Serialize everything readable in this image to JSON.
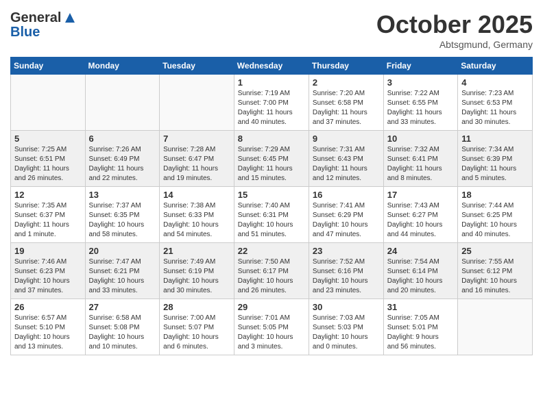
{
  "header": {
    "logo_general": "General",
    "logo_blue": "Blue",
    "month": "October 2025",
    "location": "Abtsgmund, Germany"
  },
  "days_of_week": [
    "Sunday",
    "Monday",
    "Tuesday",
    "Wednesday",
    "Thursday",
    "Friday",
    "Saturday"
  ],
  "weeks": [
    {
      "shaded": false,
      "days": [
        {
          "num": "",
          "info": ""
        },
        {
          "num": "",
          "info": ""
        },
        {
          "num": "",
          "info": ""
        },
        {
          "num": "1",
          "info": "Sunrise: 7:19 AM\nSunset: 7:00 PM\nDaylight: 11 hours\nand 40 minutes."
        },
        {
          "num": "2",
          "info": "Sunrise: 7:20 AM\nSunset: 6:58 PM\nDaylight: 11 hours\nand 37 minutes."
        },
        {
          "num": "3",
          "info": "Sunrise: 7:22 AM\nSunset: 6:55 PM\nDaylight: 11 hours\nand 33 minutes."
        },
        {
          "num": "4",
          "info": "Sunrise: 7:23 AM\nSunset: 6:53 PM\nDaylight: 11 hours\nand 30 minutes."
        }
      ]
    },
    {
      "shaded": true,
      "days": [
        {
          "num": "5",
          "info": "Sunrise: 7:25 AM\nSunset: 6:51 PM\nDaylight: 11 hours\nand 26 minutes."
        },
        {
          "num": "6",
          "info": "Sunrise: 7:26 AM\nSunset: 6:49 PM\nDaylight: 11 hours\nand 22 minutes."
        },
        {
          "num": "7",
          "info": "Sunrise: 7:28 AM\nSunset: 6:47 PM\nDaylight: 11 hours\nand 19 minutes."
        },
        {
          "num": "8",
          "info": "Sunrise: 7:29 AM\nSunset: 6:45 PM\nDaylight: 11 hours\nand 15 minutes."
        },
        {
          "num": "9",
          "info": "Sunrise: 7:31 AM\nSunset: 6:43 PM\nDaylight: 11 hours\nand 12 minutes."
        },
        {
          "num": "10",
          "info": "Sunrise: 7:32 AM\nSunset: 6:41 PM\nDaylight: 11 hours\nand 8 minutes."
        },
        {
          "num": "11",
          "info": "Sunrise: 7:34 AM\nSunset: 6:39 PM\nDaylight: 11 hours\nand 5 minutes."
        }
      ]
    },
    {
      "shaded": false,
      "days": [
        {
          "num": "12",
          "info": "Sunrise: 7:35 AM\nSunset: 6:37 PM\nDaylight: 11 hours\nand 1 minute."
        },
        {
          "num": "13",
          "info": "Sunrise: 7:37 AM\nSunset: 6:35 PM\nDaylight: 10 hours\nand 58 minutes."
        },
        {
          "num": "14",
          "info": "Sunrise: 7:38 AM\nSunset: 6:33 PM\nDaylight: 10 hours\nand 54 minutes."
        },
        {
          "num": "15",
          "info": "Sunrise: 7:40 AM\nSunset: 6:31 PM\nDaylight: 10 hours\nand 51 minutes."
        },
        {
          "num": "16",
          "info": "Sunrise: 7:41 AM\nSunset: 6:29 PM\nDaylight: 10 hours\nand 47 minutes."
        },
        {
          "num": "17",
          "info": "Sunrise: 7:43 AM\nSunset: 6:27 PM\nDaylight: 10 hours\nand 44 minutes."
        },
        {
          "num": "18",
          "info": "Sunrise: 7:44 AM\nSunset: 6:25 PM\nDaylight: 10 hours\nand 40 minutes."
        }
      ]
    },
    {
      "shaded": true,
      "days": [
        {
          "num": "19",
          "info": "Sunrise: 7:46 AM\nSunset: 6:23 PM\nDaylight: 10 hours\nand 37 minutes."
        },
        {
          "num": "20",
          "info": "Sunrise: 7:47 AM\nSunset: 6:21 PM\nDaylight: 10 hours\nand 33 minutes."
        },
        {
          "num": "21",
          "info": "Sunrise: 7:49 AM\nSunset: 6:19 PM\nDaylight: 10 hours\nand 30 minutes."
        },
        {
          "num": "22",
          "info": "Sunrise: 7:50 AM\nSunset: 6:17 PM\nDaylight: 10 hours\nand 26 minutes."
        },
        {
          "num": "23",
          "info": "Sunrise: 7:52 AM\nSunset: 6:16 PM\nDaylight: 10 hours\nand 23 minutes."
        },
        {
          "num": "24",
          "info": "Sunrise: 7:54 AM\nSunset: 6:14 PM\nDaylight: 10 hours\nand 20 minutes."
        },
        {
          "num": "25",
          "info": "Sunrise: 7:55 AM\nSunset: 6:12 PM\nDaylight: 10 hours\nand 16 minutes."
        }
      ]
    },
    {
      "shaded": false,
      "days": [
        {
          "num": "26",
          "info": "Sunrise: 6:57 AM\nSunset: 5:10 PM\nDaylight: 10 hours\nand 13 minutes."
        },
        {
          "num": "27",
          "info": "Sunrise: 6:58 AM\nSunset: 5:08 PM\nDaylight: 10 hours\nand 10 minutes."
        },
        {
          "num": "28",
          "info": "Sunrise: 7:00 AM\nSunset: 5:07 PM\nDaylight: 10 hours\nand 6 minutes."
        },
        {
          "num": "29",
          "info": "Sunrise: 7:01 AM\nSunset: 5:05 PM\nDaylight: 10 hours\nand 3 minutes."
        },
        {
          "num": "30",
          "info": "Sunrise: 7:03 AM\nSunset: 5:03 PM\nDaylight: 10 hours\nand 0 minutes."
        },
        {
          "num": "31",
          "info": "Sunrise: 7:05 AM\nSunset: 5:01 PM\nDaylight: 9 hours\nand 56 minutes."
        },
        {
          "num": "",
          "info": ""
        }
      ]
    }
  ]
}
